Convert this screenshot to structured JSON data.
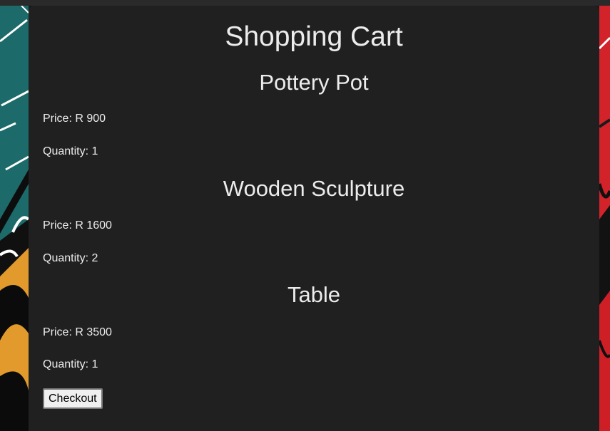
{
  "cart": {
    "title": "Shopping Cart",
    "items": [
      {
        "name": "Pottery Pot",
        "price_text": "Price: R 900",
        "quantity_text": "Quantity: 1"
      },
      {
        "name": "Wooden Sculpture",
        "price_text": "Price: R 1600",
        "quantity_text": "Quantity: 2"
      },
      {
        "name": "Table",
        "price_text": "Price: R 3500",
        "quantity_text": "Quantity: 1"
      }
    ],
    "checkout_label": "Checkout"
  },
  "colors": {
    "panel_background": "#202020",
    "text": "#ececec",
    "background_teal": "#1d6a6a",
    "background_orange": "#e39a2c",
    "background_red": "#d2232a"
  }
}
